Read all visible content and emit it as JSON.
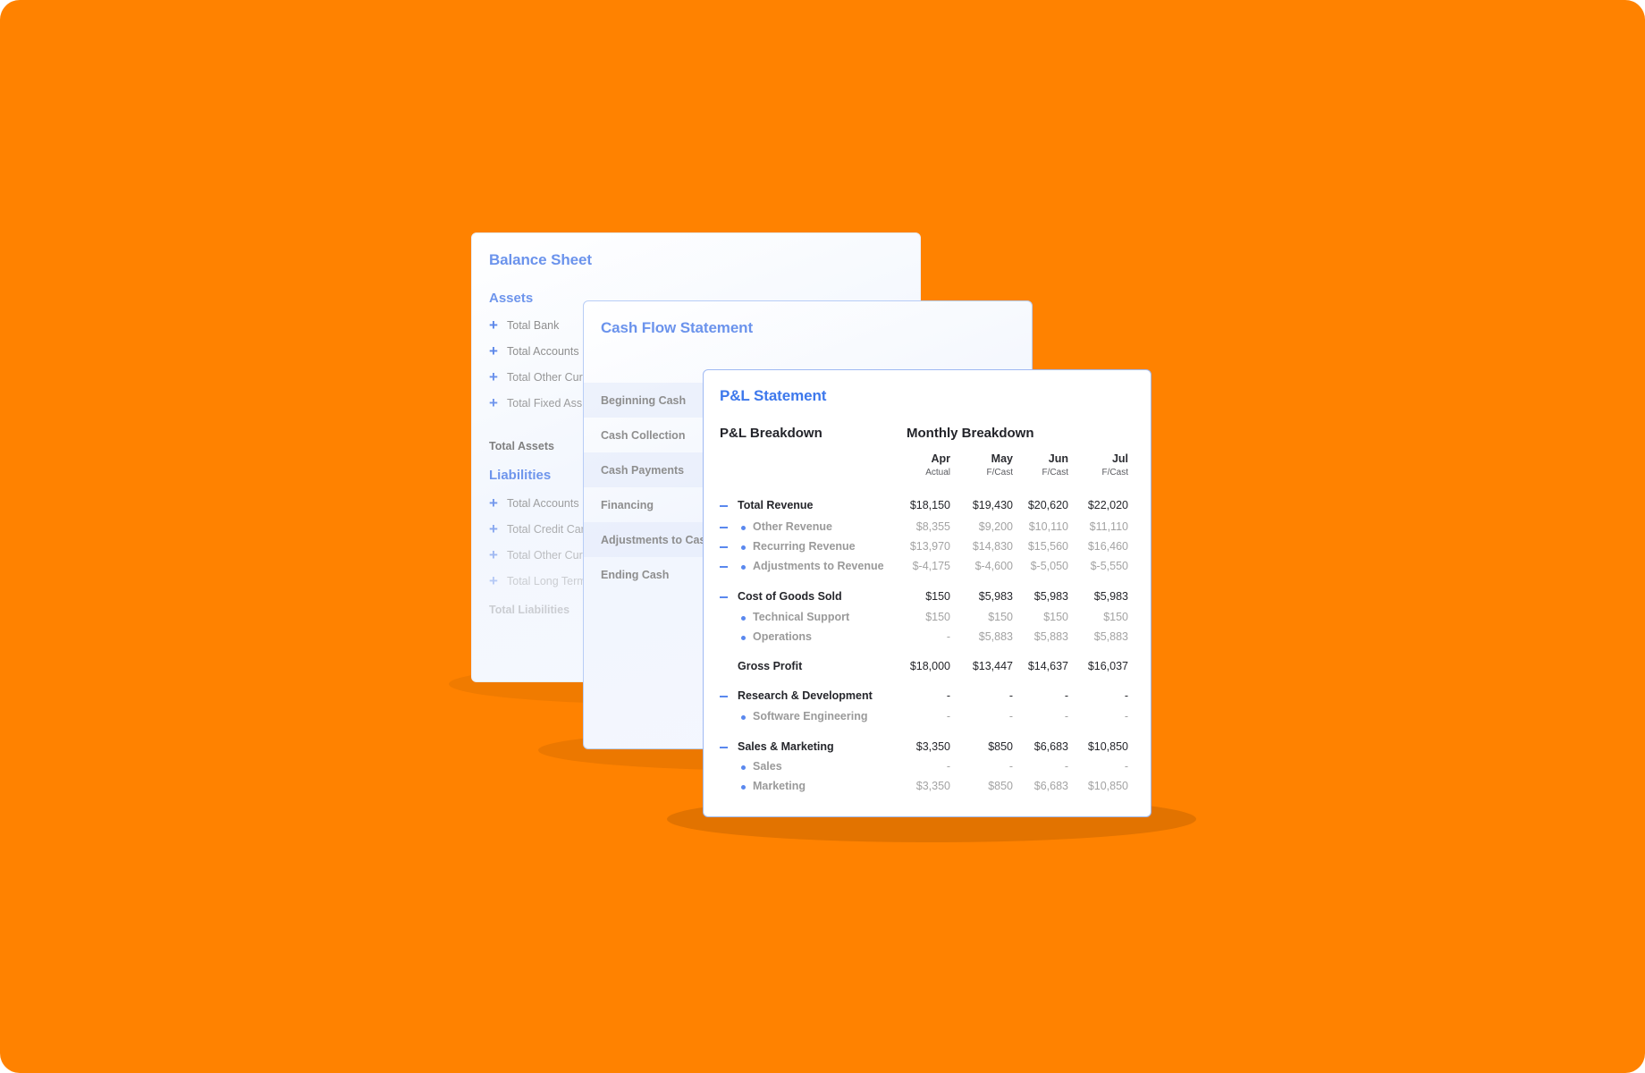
{
  "colors": {
    "background": "#FF8200",
    "accent": "#3D78EC",
    "accent_muted": "#6B93EC"
  },
  "balance_sheet": {
    "title": "Balance Sheet",
    "assets": {
      "heading": "Assets",
      "items": [
        "Total Bank",
        "Total Accounts",
        "Total Other Cur",
        "Total Fixed Ass"
      ],
      "total": "Total Assets"
    },
    "liabilities": {
      "heading": "Liabilities",
      "items": [
        "Total Accounts",
        "Total Credit Car",
        "Total Other Cur",
        "Total Long Term"
      ],
      "total": "Total Liabilities"
    }
  },
  "cash_flow": {
    "title": "Cash Flow Statement",
    "rows": [
      "Beginning Cash",
      "Cash Collection",
      "Cash Payments",
      "Financing",
      "Adjustments to Cash",
      "Ending Cash"
    ]
  },
  "pl": {
    "title": "P&L Statement",
    "breakdown_heading": "P&L Breakdown",
    "monthly_heading": "Monthly Breakdown",
    "columns": [
      {
        "month": "Apr",
        "type": "Actual"
      },
      {
        "month": "May",
        "type": "F/Cast"
      },
      {
        "month": "Jun",
        "type": "F/Cast"
      },
      {
        "month": "Jul",
        "type": "F/Cast"
      }
    ],
    "rows": [
      {
        "label": "Total Revenue",
        "level": "main",
        "collapse": true,
        "values": [
          "$18,150",
          "$19,430",
          "$20,620",
          "$22,020"
        ]
      },
      {
        "label": "Other Revenue",
        "level": "sub",
        "collapse": true,
        "values": [
          "$8,355",
          "$9,200",
          "$10,110",
          "$11,110"
        ]
      },
      {
        "label": "Recurring Revenue",
        "level": "sub",
        "collapse": true,
        "values": [
          "$13,970",
          "$14,830",
          "$15,560",
          "$16,460"
        ]
      },
      {
        "label": "Adjustments to Revenue",
        "level": "sub",
        "collapse": true,
        "values": [
          "$-4,175",
          "$-4,600",
          "$-5,050",
          "$-5,550"
        ]
      },
      {
        "label": "Cost of Goods Sold",
        "level": "main",
        "collapse": true,
        "values": [
          "$150",
          "$5,983",
          "$5,983",
          "$5,983"
        ]
      },
      {
        "label": "Technical Support",
        "level": "sub",
        "collapse": false,
        "values": [
          "$150",
          "$150",
          "$150",
          "$150"
        ]
      },
      {
        "label": "Operations",
        "level": "sub",
        "collapse": false,
        "values": [
          "-",
          "$5,883",
          "$5,883",
          "$5,883"
        ]
      },
      {
        "label": "Gross Profit",
        "level": "main",
        "collapse": false,
        "values": [
          "$18,000",
          "$13,447",
          "$14,637",
          "$16,037"
        ]
      },
      {
        "label": "Research & Development",
        "level": "main",
        "collapse": true,
        "values": [
          "-",
          "-",
          "-",
          "-"
        ]
      },
      {
        "label": "Software Engineering",
        "level": "sub",
        "collapse": false,
        "values": [
          "-",
          "-",
          "-",
          "-"
        ]
      },
      {
        "label": "Sales & Marketing",
        "level": "main",
        "collapse": true,
        "values": [
          "$3,350",
          "$850",
          "$6,683",
          "$10,850"
        ]
      },
      {
        "label": "Sales",
        "level": "sub",
        "collapse": false,
        "values": [
          "-",
          "-",
          "-",
          "-"
        ]
      },
      {
        "label": "Marketing",
        "level": "sub",
        "collapse": false,
        "values": [
          "$3,350",
          "$850",
          "$6,683",
          "$10,850"
        ]
      }
    ]
  }
}
